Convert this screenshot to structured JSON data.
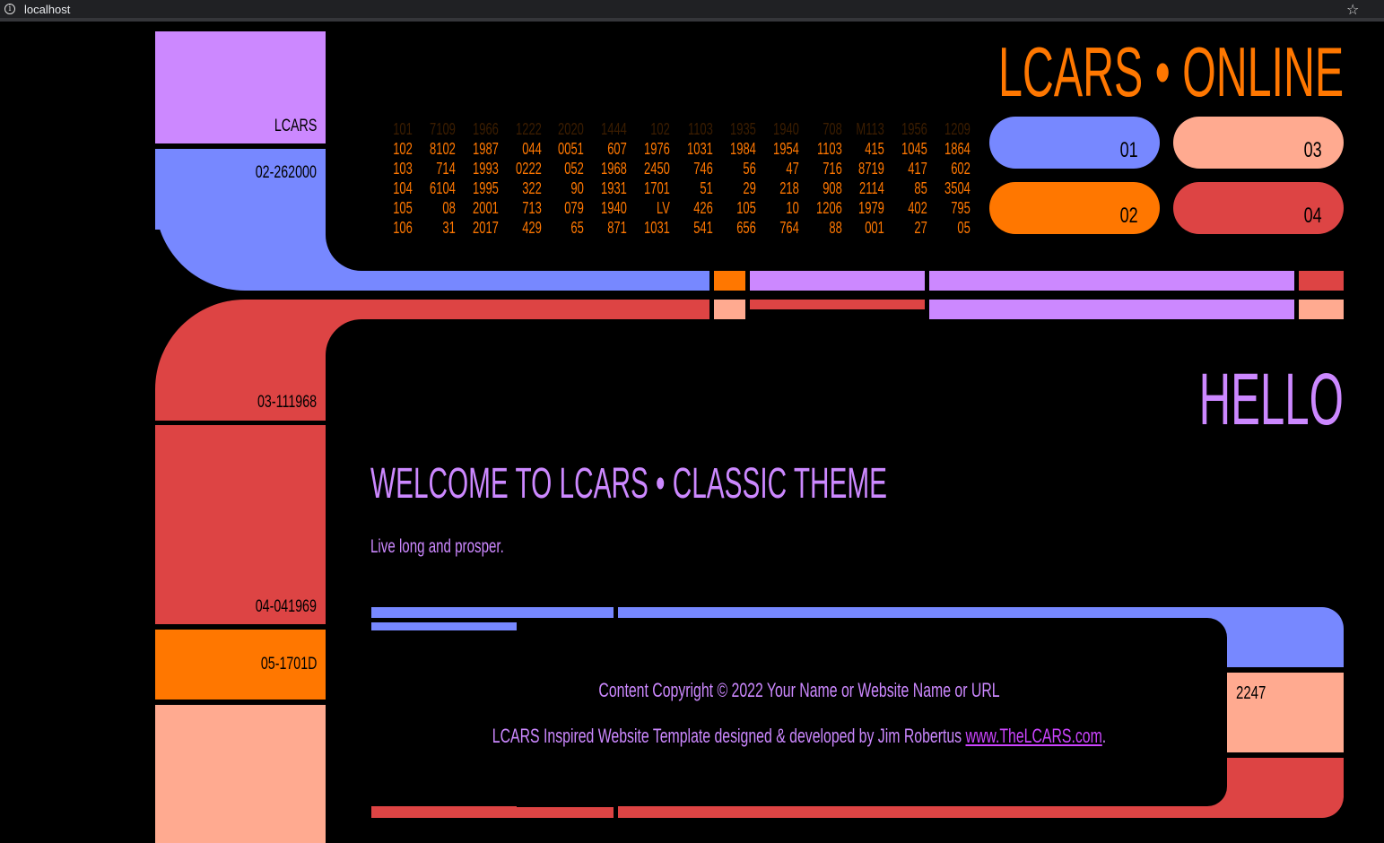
{
  "browser": {
    "url": "localhost"
  },
  "colors": {
    "violet": "#cc88ff",
    "blue": "#7788ff",
    "orange": "#ff7700",
    "red": "#dd4444",
    "peach": "#ffaa90"
  },
  "sidebar": {
    "items": [
      {
        "label": "LCARS"
      },
      {
        "label": "02-262000"
      },
      {
        "label": "03-111968"
      },
      {
        "label": "04-041969"
      },
      {
        "label": "05-1701D"
      }
    ]
  },
  "header": {
    "title": "LCARS • ONLINE",
    "numbers": [
      [
        "101",
        "7109",
        "1966",
        "1222",
        "2020",
        "1444",
        "102",
        "1103",
        "1935",
        "1940",
        "708",
        "M113",
        "1956",
        "1209"
      ],
      [
        "102",
        "8102",
        "1987",
        "044",
        "0051",
        "607",
        "1976",
        "1031",
        "1984",
        "1954",
        "1103",
        "415",
        "1045",
        "1864"
      ],
      [
        "103",
        "714",
        "1993",
        "0222",
        "052",
        "1968",
        "2450",
        "746",
        "56",
        "47",
        "716",
        "8719",
        "417",
        "602"
      ],
      [
        "104",
        "6104",
        "1995",
        "322",
        "90",
        "1931",
        "1701",
        "51",
        "29",
        "218",
        "908",
        "2114",
        "85",
        "3504"
      ],
      [
        "105",
        "08",
        "2001",
        "713",
        "079",
        "1940",
        "LV",
        "426",
        "105",
        "10",
        "1206",
        "1979",
        "402",
        "795"
      ],
      [
        "106",
        "31",
        "2017",
        "429",
        "65",
        "871",
        "1031",
        "541",
        "656",
        "764",
        "88",
        "001",
        "27",
        "05"
      ]
    ],
    "buttons": [
      {
        "label": "01"
      },
      {
        "label": "02"
      },
      {
        "label": "03"
      },
      {
        "label": "04"
      }
    ]
  },
  "main": {
    "hello": "HELLO",
    "welcome": "WELCOME TO LCARS • CLASSIC THEME",
    "tagline": "Live long and prosper."
  },
  "footer": {
    "side_label": "2247",
    "copyright": "Content Copyright © 2022 Your Name or Website Name or URL",
    "credit_prefix": "LCARS Inspired Website Template designed & developed by Jim Robertus ",
    "credit_link": "www.TheLCARS.com",
    "credit_suffix": "."
  }
}
